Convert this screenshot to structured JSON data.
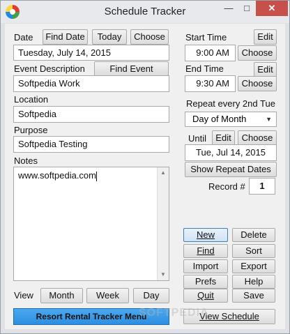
{
  "window": {
    "title": "Schedule Tracker",
    "minimize": "—",
    "maximize": "□",
    "close": "✕"
  },
  "date": {
    "label": "Date",
    "find_date": "Find Date",
    "today": "Today",
    "choose": "Choose",
    "value": "Tuesday, July 14, 2015"
  },
  "event": {
    "label": "Event Description",
    "find_event": "Find Event",
    "value": "Softpedia Work"
  },
  "location": {
    "label": "Location",
    "value": "Softpedia"
  },
  "purpose": {
    "label": "Purpose",
    "value": "Softpedia Testing"
  },
  "notes": {
    "label": "Notes",
    "value": "www.softpedia.com"
  },
  "view": {
    "label": "View",
    "month": "Month",
    "week": "Week",
    "day": "Day"
  },
  "resort_menu": "Resort Rental Tracker Menu",
  "start_time": {
    "label": "Start Time",
    "edit": "Edit",
    "value": "9:00 AM",
    "choose": "Choose"
  },
  "end_time": {
    "label": "End Time",
    "edit": "Edit",
    "value": "9:30 AM",
    "choose": "Choose"
  },
  "repeat": {
    "label": "Repeat every 2nd Tue",
    "selected": "Day of Month"
  },
  "until": {
    "label": "Until",
    "edit": "Edit",
    "choose": "Choose",
    "value": "Tue, Jul 14, 2015",
    "show_repeat": "Show Repeat Dates"
  },
  "record": {
    "label": "Record #",
    "value": "1"
  },
  "actions": {
    "new": "New",
    "delete": "Delete",
    "find": "Find",
    "sort": "Sort",
    "import": "Import",
    "export": "Export",
    "prefs": "Prefs",
    "help": "Help",
    "quit": "Quit",
    "save": "Save",
    "view_schedule": "View Schedule"
  },
  "watermark": "SOFTPEDIA"
}
